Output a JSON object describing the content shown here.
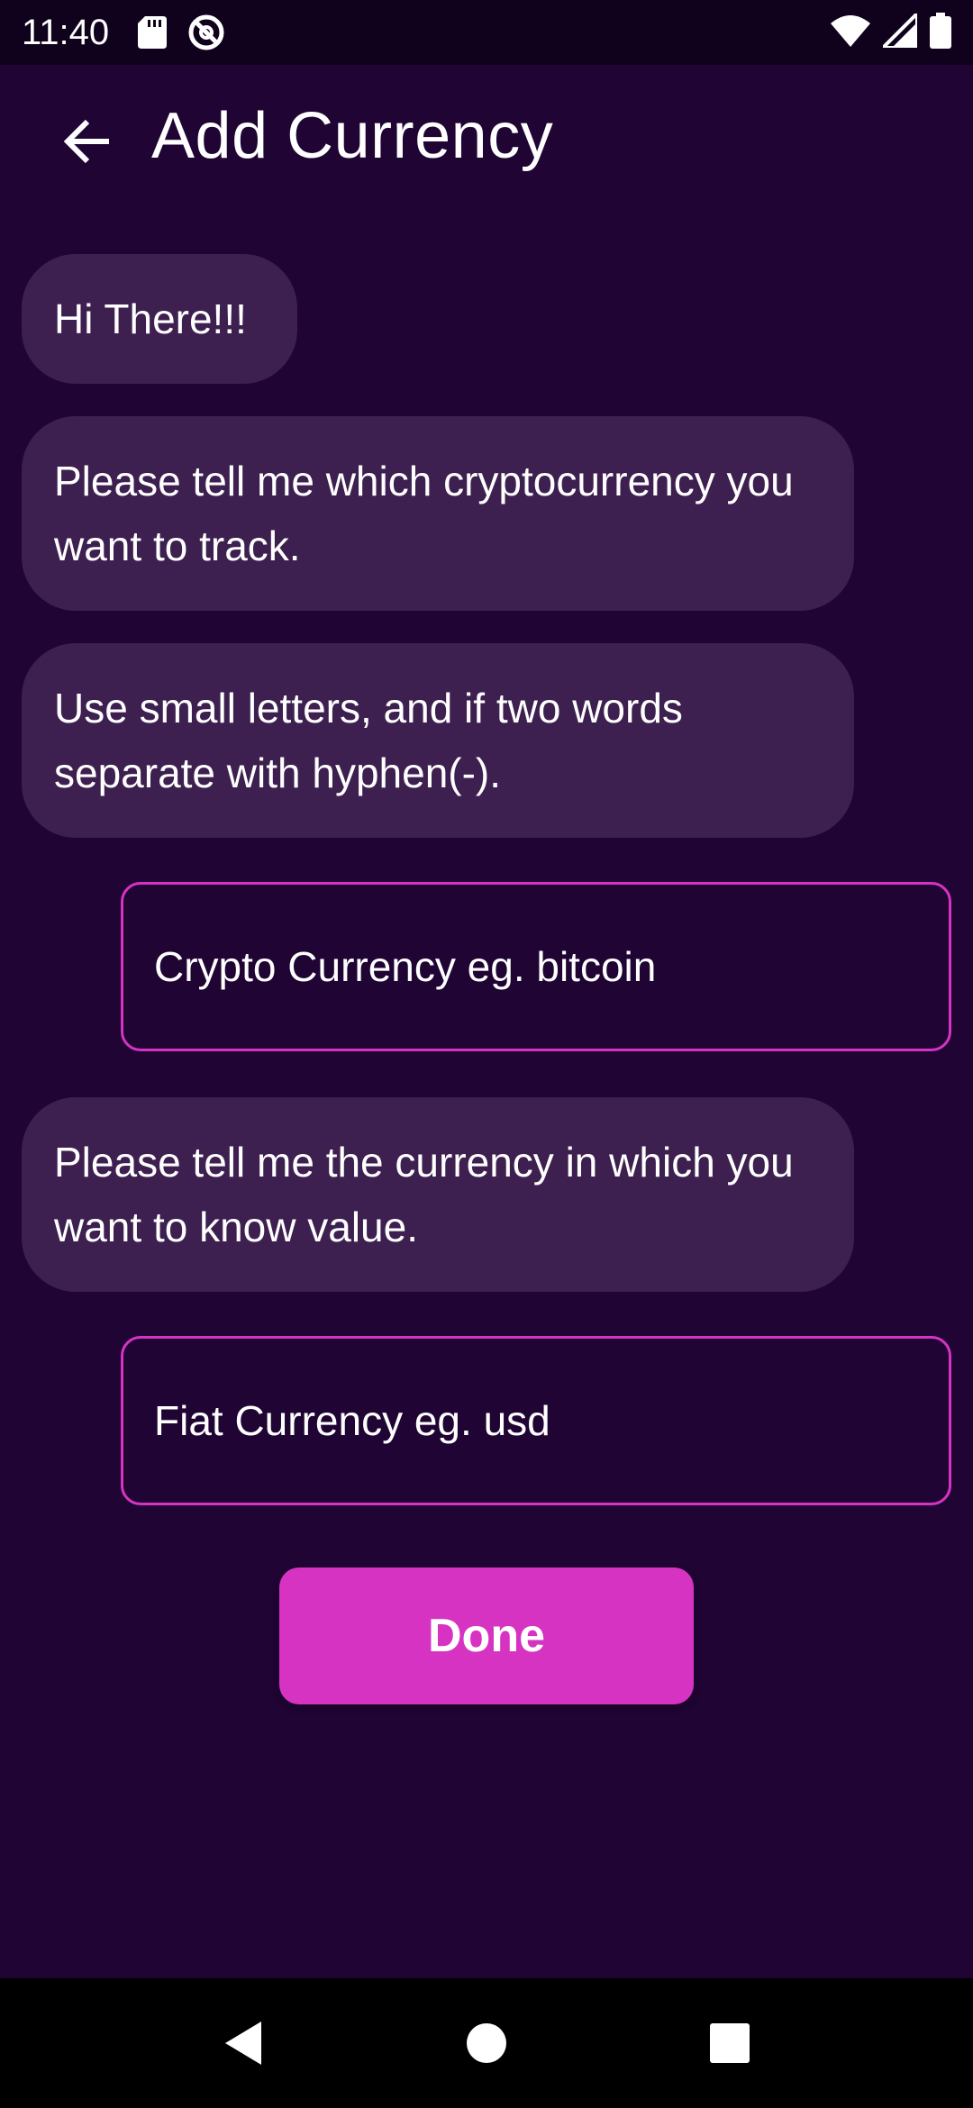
{
  "status_bar": {
    "time": "11:40",
    "icons": [
      "sd-card-icon",
      "no-disturb-icon",
      "wifi-icon",
      "cell-signal-icon",
      "battery-icon"
    ]
  },
  "app_bar": {
    "title": "Add Currency",
    "back_icon": "arrow-left-icon"
  },
  "messages": [
    {
      "text": "Hi There!!!"
    },
    {
      "text": "Please tell me which cryptocurrency you want to track."
    },
    {
      "text": "Use small letters, and if two words separate with hyphen(-)."
    },
    {
      "text": "Please tell me the currency in which you want to know value."
    }
  ],
  "inputs": {
    "crypto": {
      "placeholder": "Crypto Currency eg. bitcoin",
      "value": ""
    },
    "fiat": {
      "placeholder": "Fiat Currency eg. usd",
      "value": ""
    }
  },
  "done_button": {
    "label": "Done"
  },
  "nav_bar": {
    "icons": [
      "nav-back-icon",
      "nav-home-icon",
      "nav-recents-icon"
    ]
  },
  "colors": {
    "background": "#1f0434",
    "status_bar": "#10021c",
    "bubble": "#3d2050",
    "accent": "#d633c3",
    "nav_bar": "#000000"
  }
}
